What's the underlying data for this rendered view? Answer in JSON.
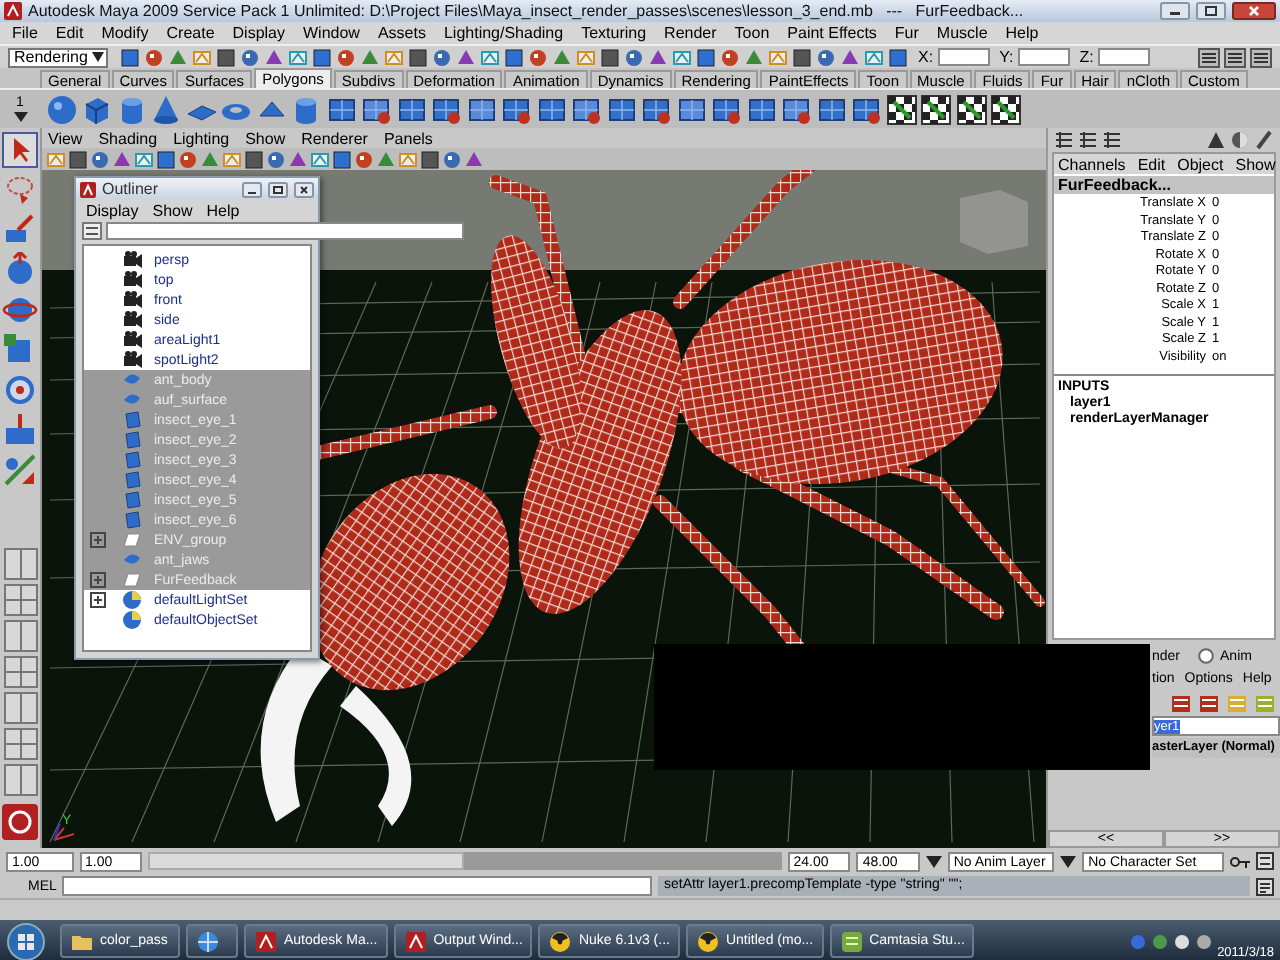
{
  "window": {
    "title": "Autodesk Maya 2009 Service Pack 1 Unlimited: D:\\Project Files\\Maya_insect_render_passes\\scenes\\lesson_3_end.mb   ---   FurFeedback..."
  },
  "menu": [
    "File",
    "Edit",
    "Modify",
    "Create",
    "Display",
    "Window",
    "Assets",
    "Lighting/Shading",
    "Texturing",
    "Render",
    "Toon",
    "Paint Effects",
    "Fur",
    "Muscle",
    "Help"
  ],
  "status_line": {
    "menu_set": "Rendering",
    "x_label": "X:",
    "y_label": "Y:",
    "z_label": "Z:"
  },
  "shelf": {
    "tabs": [
      {
        "label": "General",
        "selected": false
      },
      {
        "label": "Curves",
        "selected": false
      },
      {
        "label": "Surfaces",
        "selected": false
      },
      {
        "label": "Polygons",
        "selected": true
      },
      {
        "label": "Subdivs",
        "selected": false
      },
      {
        "label": "Deformation",
        "selected": false
      },
      {
        "label": "Animation",
        "selected": false
      },
      {
        "label": "Dynamics",
        "selected": false
      },
      {
        "label": "Rendering",
        "selected": false
      },
      {
        "label": "PaintEffects",
        "selected": false
      },
      {
        "label": "Toon",
        "selected": false
      },
      {
        "label": "Muscle",
        "selected": false
      },
      {
        "label": "Fluids",
        "selected": false
      },
      {
        "label": "Fur",
        "selected": false
      },
      {
        "label": "Hair",
        "selected": false
      },
      {
        "label": "nCloth",
        "selected": false
      },
      {
        "label": "Custom",
        "selected": false
      }
    ],
    "scroll_label": "1"
  },
  "viewport": {
    "menu": [
      "View",
      "Shading",
      "Lighting",
      "Show",
      "Renderer",
      "Panels"
    ],
    "axis_label": "Y"
  },
  "outliner": {
    "title": "Outliner",
    "menu": [
      "Display",
      "Show",
      "Help"
    ],
    "items": [
      {
        "name": "persp",
        "kind": "camera",
        "selected": false,
        "expandable": false
      },
      {
        "name": "top",
        "kind": "camera",
        "selected": false,
        "expandable": false
      },
      {
        "name": "front",
        "kind": "camera",
        "selected": false,
        "expandable": false
      },
      {
        "name": "side",
        "kind": "camera",
        "selected": false,
        "expandable": false
      },
      {
        "name": "areaLight1",
        "kind": "camera",
        "selected": false,
        "expandable": false
      },
      {
        "name": "spotLight2",
        "kind": "camera",
        "selected": false,
        "expandable": false
      },
      {
        "name": "ant_body",
        "kind": "surface",
        "selected": true,
        "expandable": false
      },
      {
        "name": "auf_surface",
        "kind": "surface",
        "selected": true,
        "expandable": false
      },
      {
        "name": "insect_eye_1",
        "kind": "mesh",
        "selected": true,
        "expandable": false
      },
      {
        "name": "insect_eye_2",
        "kind": "mesh",
        "selected": true,
        "expandable": false
      },
      {
        "name": "insect_eye_3",
        "kind": "mesh",
        "selected": true,
        "expandable": false
      },
      {
        "name": "insect_eye_4",
        "kind": "mesh",
        "selected": true,
        "expandable": false
      },
      {
        "name": "insect_eye_5",
        "kind": "mesh",
        "selected": true,
        "expandable": false
      },
      {
        "name": "insect_eye_6",
        "kind": "mesh",
        "selected": true,
        "expandable": false
      },
      {
        "name": "ENV_group",
        "kind": "group",
        "selected": true,
        "expandable": true
      },
      {
        "name": "ant_jaws",
        "kind": "surface",
        "selected": true,
        "expandable": false
      },
      {
        "name": "FurFeedback",
        "kind": "group",
        "selected": true,
        "expandable": true
      },
      {
        "name": "defaultLightSet",
        "kind": "set",
        "selected": false,
        "expandable": true
      },
      {
        "name": "defaultObjectSet",
        "kind": "set",
        "selected": false,
        "expandable": false
      }
    ]
  },
  "channel_box": {
    "menu": [
      "Channels",
      "Edit",
      "Object",
      "Show"
    ],
    "object": "FurFeedback...",
    "attributes": [
      {
        "name": "Translate X",
        "value": "0"
      },
      {
        "name": "Translate Y",
        "value": "0"
      },
      {
        "name": "Translate Z",
        "value": "0"
      },
      {
        "name": "Rotate X",
        "value": "0"
      },
      {
        "name": "Rotate Y",
        "value": "0"
      },
      {
        "name": "Rotate Z",
        "value": "0"
      },
      {
        "name": "Scale X",
        "value": "1"
      },
      {
        "name": "Scale Y",
        "value": "1"
      },
      {
        "name": "Scale Z",
        "value": "1"
      },
      {
        "name": "Visibility",
        "value": "on"
      }
    ],
    "inputs_heading": "INPUTS",
    "inputs": [
      "layer1",
      "renderLayerManager"
    ]
  },
  "layer_editor": {
    "render_label": "nder",
    "anim": {
      "label": "Anim",
      "selected": false
    },
    "menu": [
      "tion",
      "Options",
      "Help"
    ],
    "layers": [
      {
        "name": "yer1",
        "selected": true
      },
      {
        "name": "asterLayer (Normal)",
        "selected": false
      }
    ],
    "nav": [
      "<<",
      ">>"
    ]
  },
  "time_slider": {
    "start": "1.00",
    "range_start": "1.00",
    "level": 0.5,
    "range_end": "24.00",
    "end": "48.00",
    "anim_layer": "No Anim Layer",
    "character_set": "No Character Set"
  },
  "command_line": {
    "label": "MEL",
    "result": "setAttr layer1.precompTemplate -type \"string\" \"\";"
  },
  "taskbar": {
    "items": [
      {
        "kind": "folder",
        "label": "color_pass"
      },
      {
        "kind": "browser"
      },
      {
        "kind": "maya",
        "label": "Autodesk Ma..."
      },
      {
        "kind": "maya",
        "label": "Output Wind..."
      },
      {
        "kind": "nuke",
        "label": "Nuke 6.1v3 (..."
      },
      {
        "kind": "nuke",
        "label": "Untitled (mo..."
      },
      {
        "kind": "camtasia",
        "label": "Camtasia Stu..."
      }
    ],
    "clock": "2011/3/18"
  }
}
